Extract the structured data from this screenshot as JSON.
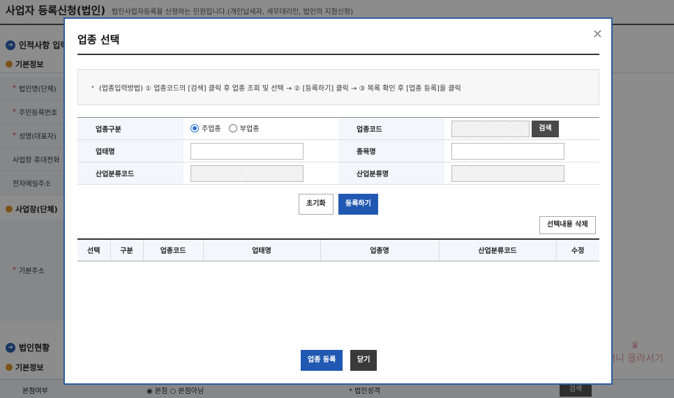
{
  "page": {
    "title": "사업자 등록신청(법인)",
    "subtitle": "법인사업자등록을 신청하는 민원입니다.(개인납세자, 세무대리인, 법인의 지점신청)",
    "section1": "인적사항 입력",
    "basic_info": "기본정보",
    "fields": [
      "법인명(단체)",
      "주민등록번호",
      "성명(대표자)",
      "사업장 휴대전화",
      "전자메일주소"
    ],
    "business_section": "사업장(단체)",
    "base_address": "기본주소",
    "section2": "법인현황",
    "basic_info2": "기본정보",
    "bottom_label": "본점여부",
    "bottom_radio": "◉ 본점 ○ 본점아님",
    "bottom_label2": "* 법인성격",
    "bottom_btn": "검색",
    "scroll_top": "머니 올라서기"
  },
  "modal": {
    "title": "업종 선택",
    "guide": "(업종입력방법) ① 업종코드의 [검색] 클릭 후 업종 조회 및 선택 → ② [등록하기] 클릭 → ③ 목록 확인 후 [업종 등록]을 클릭",
    "form": {
      "type_label": "업종구분",
      "radio_main": "주업종",
      "radio_sub": "부업종",
      "code_label": "업종코드",
      "search_btn": "검색",
      "biz_label": "업태명",
      "item_label": "종목명",
      "ind_code_label": "산업분류코드",
      "ind_name_label": "산업분류명"
    },
    "reset_btn": "초기화",
    "register_btn": "등록하기",
    "delete_btn": "선택내용 삭제",
    "table_headers": [
      "선택",
      "구분",
      "업종코드",
      "업태명",
      "업종명",
      "산업분류코드",
      "수정"
    ],
    "submit_btn": "업종 등록",
    "close_btn": "닫기"
  }
}
